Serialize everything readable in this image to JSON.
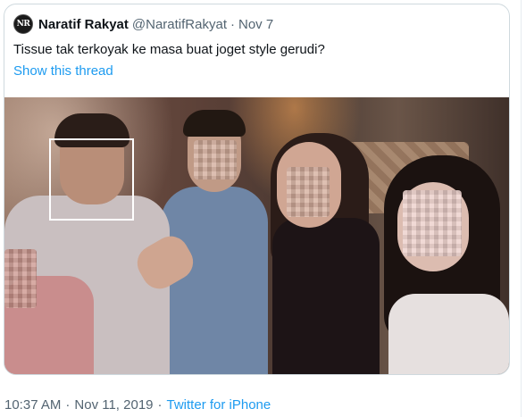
{
  "quoted_tweet": {
    "avatar_text": "NR",
    "display_name": "Naratif Rakyat",
    "handle": "@NaratifRakyat",
    "separator": "·",
    "date": "Nov 7",
    "text": "Tissue tak terkoyak ke masa buat joget style gerudi?",
    "show_thread_label": "Show this thread"
  },
  "footer": {
    "time": "10:37 AM",
    "separator": "·",
    "date": "Nov 11, 2019",
    "source": "Twitter for iPhone"
  },
  "colors": {
    "link": "#1d9bf0",
    "secondary_text": "#536471",
    "border": "#cfd9de"
  }
}
